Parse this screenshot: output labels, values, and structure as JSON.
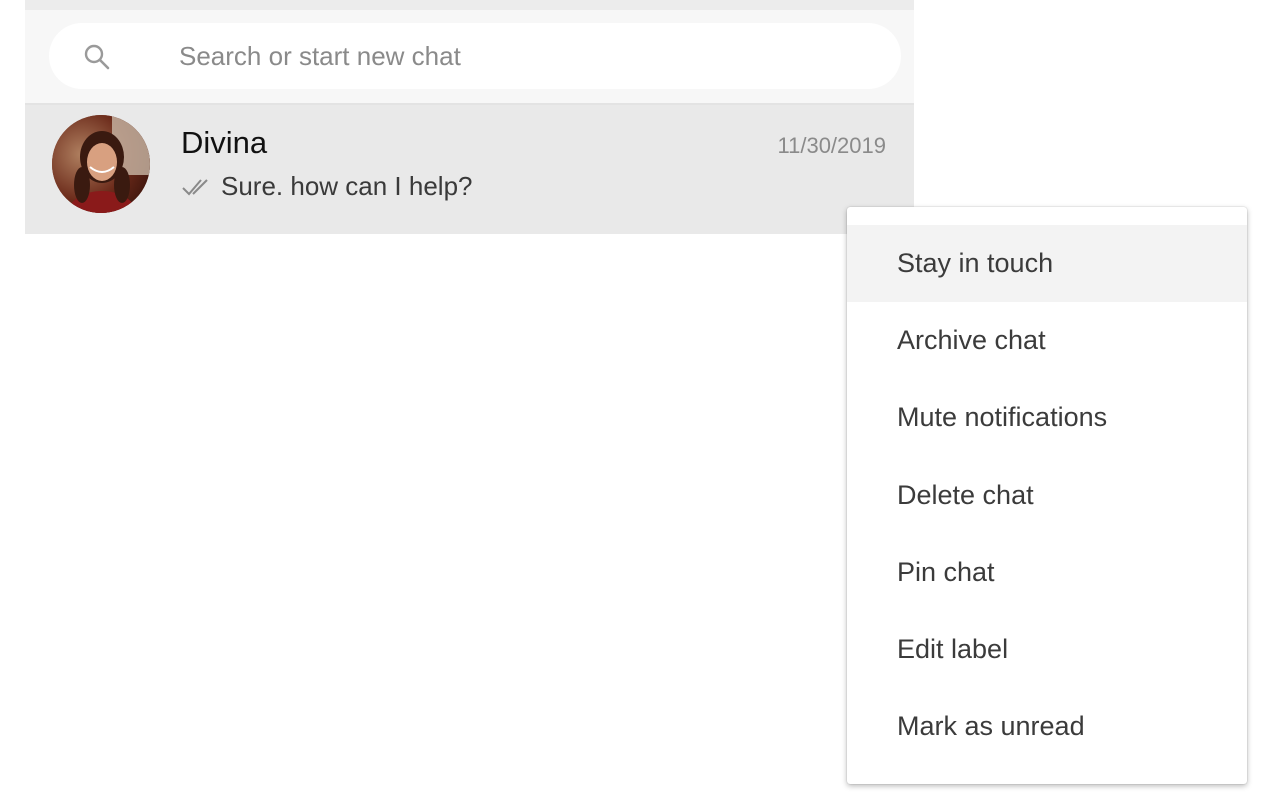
{
  "search": {
    "placeholder": "Search or start new chat",
    "value": "",
    "icon": "search-icon"
  },
  "chat": {
    "name": "Divina",
    "date": "11/30/2019",
    "preview": "Sure. how can I help?",
    "status_icon": "double-check-icon",
    "avatar_icon": "avatar"
  },
  "context_menu": {
    "items": [
      {
        "label": "Stay in touch",
        "hovered": true
      },
      {
        "label": "Archive chat"
      },
      {
        "label": "Mute notifications"
      },
      {
        "label": "Delete chat"
      },
      {
        "label": "Pin chat"
      },
      {
        "label": "Edit label"
      },
      {
        "label": "Mark as unread"
      }
    ]
  },
  "colors": {
    "panel_bg": "#f7f7f7",
    "selected_row_bg": "#e9e9e9",
    "menu_hover_bg": "#f3f3f3",
    "ticks": "#8a8a8a"
  }
}
